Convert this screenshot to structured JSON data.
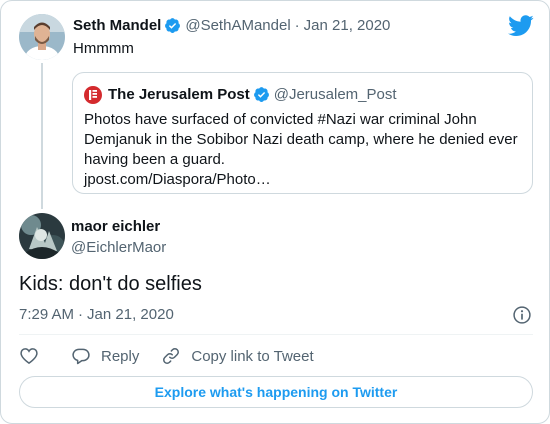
{
  "colors": {
    "accent": "#1d9bf0",
    "text_primary": "#0f1419",
    "text_secondary": "#536471",
    "border": "#cfd9de",
    "jpost_red": "#d42a2e"
  },
  "icons": {
    "brand": "twitter-bird-icon",
    "verified": "verified-badge-icon",
    "info": "info-icon",
    "like": "heart-icon",
    "reply": "speech-bubble-icon",
    "copy_link": "link-icon"
  },
  "parent_tweet": {
    "author": {
      "display_name": "Seth Mandel",
      "handle": "@SethAMandel"
    },
    "separator": "·",
    "date": "Jan 21, 2020",
    "text": "Hmmmm",
    "quoted_tweet": {
      "author": {
        "display_name": "The Jerusalem Post",
        "handle": "@Jerusalem_Post"
      },
      "text_lines": [
        "Photos have surfaced of convicted #Nazi war criminal John",
        "Demjanuk in the Sobibor Nazi death camp, where he denied ever",
        "having been a guard."
      ],
      "link_text": "jpost.com/Diaspora/Photo…"
    }
  },
  "reply_tweet": {
    "author": {
      "display_name": "maor eichler",
      "handle": "@EichlerMaor"
    },
    "text": "Kids: don't do selfies",
    "time": "7:29 AM",
    "separator": "·",
    "date": "Jan 21, 2020"
  },
  "actions": {
    "reply_label": "Reply",
    "copy_link_label": "Copy link to Tweet"
  },
  "footer": {
    "explore_label": "Explore what's happening on Twitter"
  }
}
